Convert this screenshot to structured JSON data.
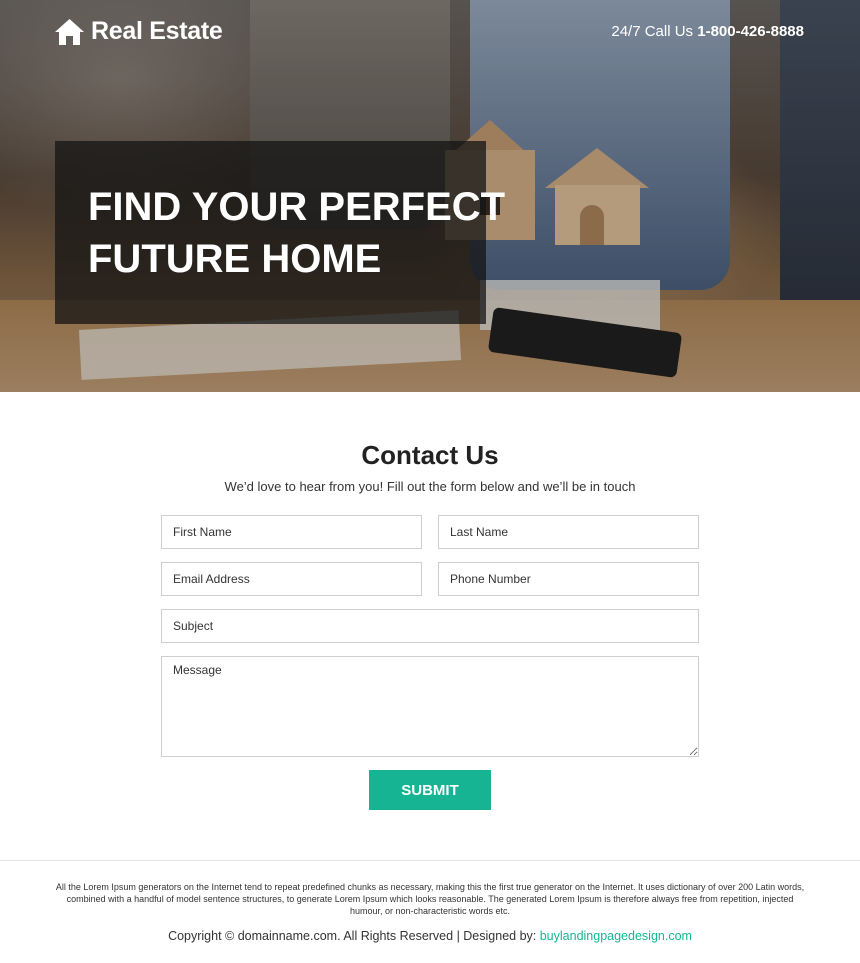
{
  "header": {
    "brand_name": "Real Estate",
    "call_prefix": "24/7 Call Us",
    "phone_number": "1-800-426-8888",
    "home_icon": "home-icon"
  },
  "hero": {
    "headline_line1": "FIND YOUR PERFECT",
    "headline_line2": "FUTURE HOME"
  },
  "contact": {
    "title": "Contact Us",
    "subtitle": "We’d love to hear from you! Fill out the form below and we’ll be in touch",
    "fields": {
      "first_name_placeholder": "First Name",
      "last_name_placeholder": "Last Name",
      "email_placeholder": "Email Address",
      "phone_placeholder": "Phone Number",
      "subject_placeholder": "Subject",
      "message_placeholder": "Message"
    },
    "submit_label": "SUBMIT"
  },
  "footer": {
    "disclaimer": "All the Lorem Ipsum generators on the Internet tend to repeat predefined chunks as necessary, making this the first true generator on the Internet. It uses dictionary of over 200 Latin words, combined with a handful of model sentence structures, to generate Lorem Ipsum which looks reasonable. The generated Lorem Ipsum is therefore always free from repetition, injected humour, or non-characteristic words etc.",
    "copyright_text": "Copyright © domainname.com. All Rights Reserved | Designed by:",
    "designer_link": "buylandingpagedesign.com"
  },
  "colors": {
    "accent": "#17b494",
    "headline_box": "#141414"
  }
}
